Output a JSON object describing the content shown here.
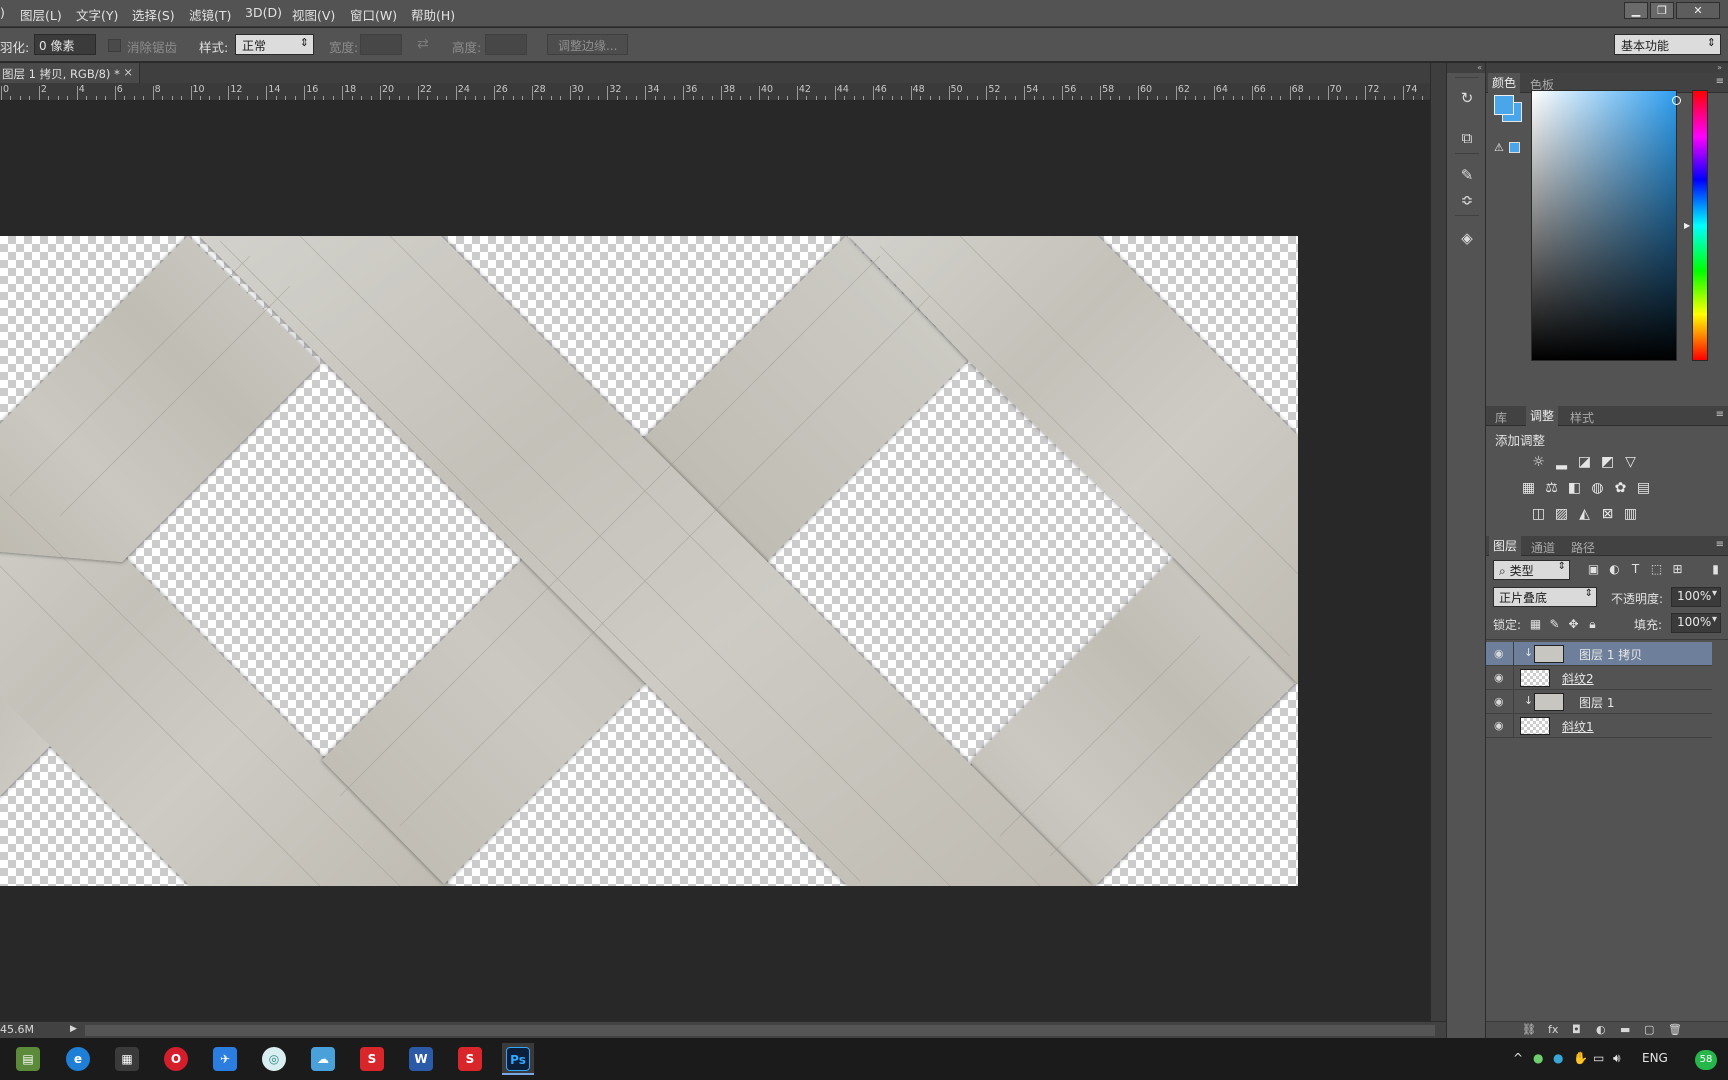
{
  "menubar": {
    "items": [
      ")",
      "图层(L)",
      "文字(Y)",
      "选择(S)",
      "滤镜(T)",
      "3D(D)",
      "视图(V)",
      "窗口(W)",
      "帮助(H)"
    ],
    "window_controls": [
      "▁",
      "❐",
      "✕"
    ]
  },
  "options": {
    "feather_label": "羽化:",
    "feather_value": "0 像素",
    "antialias_label": "消除锯齿",
    "style_label": "样式:",
    "style_value": "正常",
    "width_label": "宽度:",
    "height_label": "高度:",
    "refine_edge_button": "调整边缘...",
    "workspace_value": "基本功能"
  },
  "document": {
    "tab_title": "图层 1 拷贝, RGB/8) *",
    "tab_close": "×"
  },
  "ruler": {
    "labels": [
      "0",
      "2",
      "4",
      "6",
      "8",
      "10",
      "12",
      "14",
      "16",
      "18",
      "20",
      "22",
      "24",
      "26",
      "28",
      "30",
      "32",
      "34",
      "36",
      "38",
      "40",
      "42",
      "44",
      "46",
      "48",
      "50",
      "52",
      "54",
      "56",
      "58",
      "60",
      "62",
      "64",
      "66",
      "68",
      "70",
      "72",
      "74"
    ]
  },
  "statusbar": {
    "doc_size": "45.6M",
    "play_icon": "▶"
  },
  "toolstrip": {
    "icons": [
      "history-icon",
      "layer-comps-icon",
      "brush-presets-icon",
      "properties-icon",
      "3d-icon"
    ]
  },
  "color_panel": {
    "tabs": [
      "颜色",
      "色板"
    ],
    "foreground_color": "#4aa6ea",
    "menu_icon": "≡"
  },
  "adjustments_panel": {
    "tabs": [
      "库",
      "调整",
      "样式"
    ],
    "active_tab": "调整",
    "title": "添加调整"
  },
  "layers_panel": {
    "tabs": [
      "图层",
      "通道",
      "路径"
    ],
    "filter_value": "类型",
    "blend_mode": "正片叠底",
    "opacity_label": "不透明度:",
    "opacity_value": "100%",
    "lock_label": "锁定:",
    "fill_label": "填充:",
    "fill_value": "100%",
    "layers": [
      {
        "name": "图层 1 拷贝",
        "selected": true,
        "clipped": true,
        "thumb": "solid"
      },
      {
        "name": "斜纹2",
        "selected": false,
        "clipped": false,
        "thumb": "checker"
      },
      {
        "name": "图层 1",
        "selected": false,
        "clipped": true,
        "thumb": "solid"
      },
      {
        "name": "斜纹1",
        "selected": false,
        "clipped": false,
        "thumb": "checker"
      }
    ]
  },
  "taskbar": {
    "apps": [
      "file-manager",
      "edge",
      "calculator",
      "opera",
      "feishu",
      "360",
      "netdisk",
      "sketchup-1",
      "word",
      "sketchup-2",
      "photoshop"
    ],
    "ps_label": "Ps",
    "word_label": "W",
    "language": "ENG",
    "badge": "58"
  }
}
